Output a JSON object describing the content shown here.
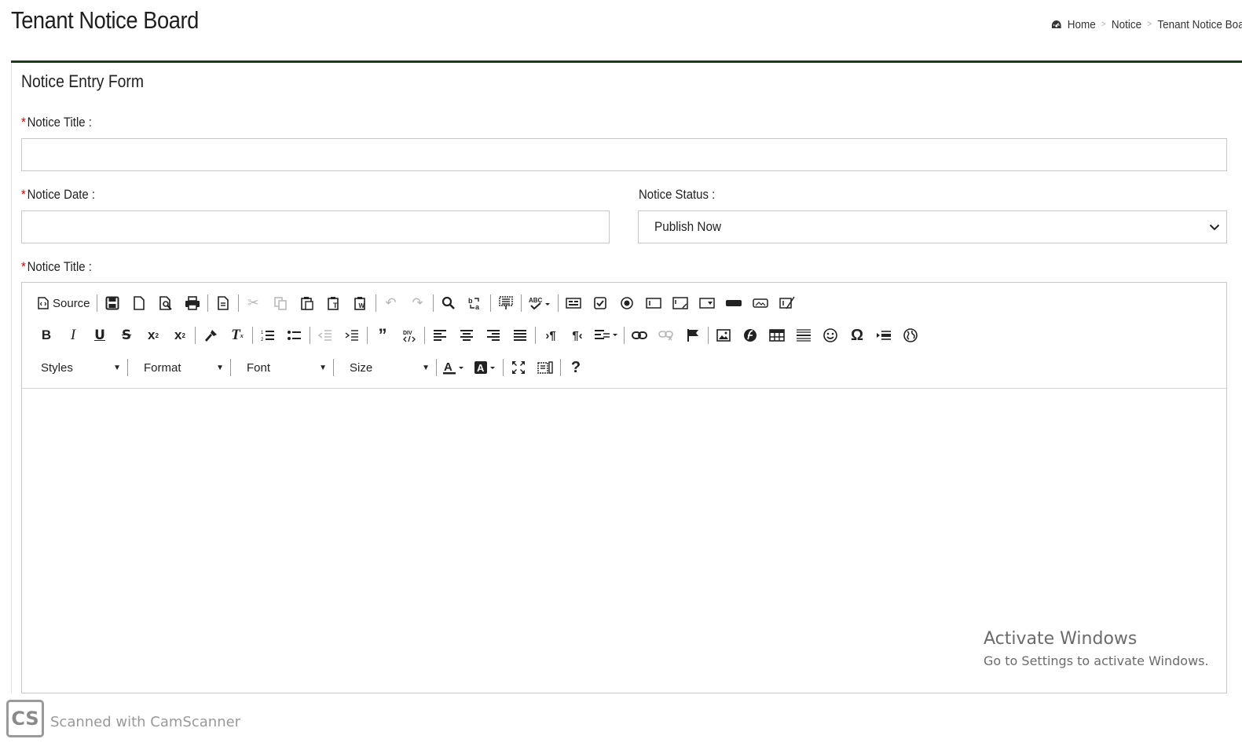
{
  "header": {
    "title": "Tenant Notice Board",
    "breadcrumb": [
      "Home",
      "Notice",
      "Tenant Notice Board"
    ],
    "breadcrumb_separator": ">",
    "home_icon": "dashboard-icon"
  },
  "form": {
    "title": "Notice Entry Form",
    "required_mark": "*",
    "notice_title_label": "Notice Title :",
    "notice_title_value": "",
    "notice_date_label": "Notice Date :",
    "notice_date_value": "",
    "notice_status_label": "Notice Status :",
    "notice_status_value": "Publish Now",
    "content_label": "Notice Title :"
  },
  "editor": {
    "source_label": "Source",
    "combos": [
      "Styles",
      "Format",
      "Font",
      "Size"
    ],
    "toolbar_row1_icons": [
      "save-icon",
      "new-page-icon",
      "preview-icon",
      "print-icon",
      "templates-icon",
      "cut-icon",
      "copy-icon",
      "paste-icon",
      "paste-text-icon",
      "paste-word-icon",
      "undo-icon",
      "redo-icon",
      "find-icon",
      "replace-icon",
      "select-all-icon",
      "spellcheck-icon",
      "form-icon",
      "checkbox-icon",
      "radio-icon",
      "textfield-icon",
      "textarea-icon",
      "select-icon",
      "button-icon",
      "image-button-icon",
      "hidden-field-icon"
    ],
    "toolbar_row2_icons": [
      "bold-icon",
      "italic-icon",
      "underline-icon",
      "strike-icon",
      "subscript-icon",
      "superscript-icon",
      "copy-format-icon",
      "remove-format-icon",
      "numbered-list-icon",
      "bulleted-list-icon",
      "outdent-icon",
      "indent-icon",
      "blockquote-icon",
      "create-div-icon",
      "align-left-icon",
      "align-center-icon",
      "align-right-icon",
      "justify-icon",
      "ltr-icon",
      "rtl-icon",
      "language-icon",
      "link-icon",
      "unlink-icon",
      "anchor-icon",
      "image-icon",
      "flash-icon",
      "table-icon",
      "horizontal-rule-icon",
      "smiley-icon",
      "special-char-icon",
      "page-break-icon",
      "iframe-icon"
    ],
    "toolbar_row3_icons": [
      "text-color-icon",
      "background-color-icon",
      "maximize-icon",
      "show-blocks-icon",
      "help-icon"
    ],
    "body_text": ""
  },
  "overlay": {
    "activate_title": "Activate Windows",
    "activate_sub": "Go to Settings to activate Windows.",
    "scanner_logo": "CS",
    "scanner_text": "Scanned with CamScanner"
  },
  "colors": {
    "accent_rule": "#1a3d16",
    "required": "#dd0000"
  }
}
